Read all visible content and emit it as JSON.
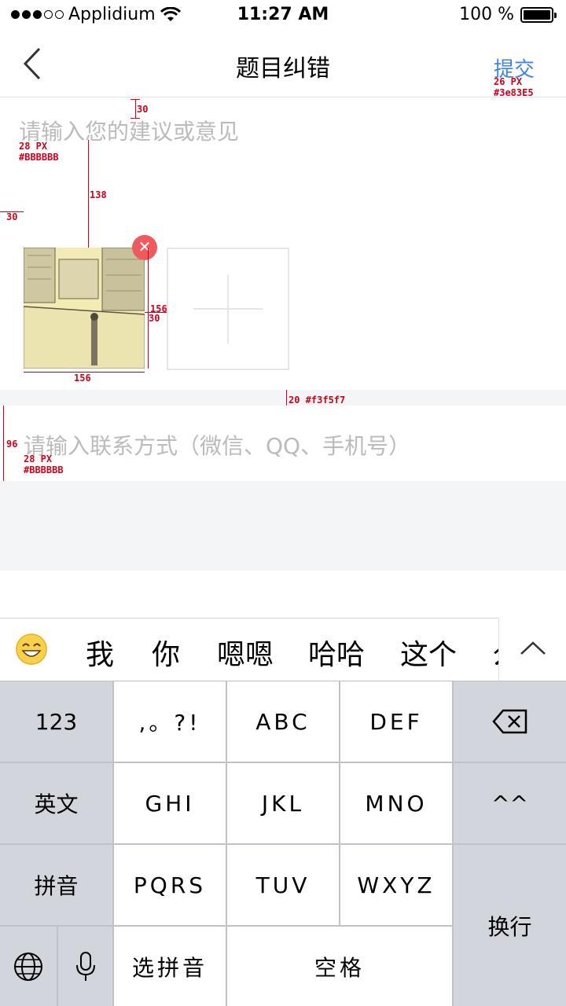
{
  "status_bar": {
    "carrier": "Applidium",
    "time": "11:27 AM",
    "battery": "100 %"
  },
  "nav": {
    "title": "题目纠错",
    "submit_label": "提交"
  },
  "feedback": {
    "placeholder": "请输入您的建议或意见"
  },
  "contact": {
    "placeholder": "请输入联系方式（微信、QQ、手机号）"
  },
  "annotations": {
    "top_gap": "30",
    "placeholder_font": "28 PX",
    "placeholder_color": "#BBBBBB",
    "gap_138": "138",
    "left_margin": "30",
    "thumb_height": "156",
    "thumb_gap": "30",
    "thumb_width": "156",
    "sep": "20 #f3f5f7",
    "row_height": "96",
    "contact_font": "28 PX",
    "contact_color": "#BBBBBB",
    "submit_font": "26 PX",
    "submit_color": "#3e83E5"
  },
  "colors": {
    "accent": "#3e83e5",
    "placeholder": "#bbbbbb",
    "separator": "#f3f5f7",
    "remove": "#ef5a5f"
  },
  "suggestions": [
    "我",
    "你",
    "嗯嗯",
    "哈哈",
    "这个",
    "么"
  ],
  "keyboard": {
    "row1": [
      "123",
      ",。?!",
      "ABC",
      "DEF"
    ],
    "row2": [
      "英文",
      "GHI",
      "JKL",
      "MNO",
      "^^"
    ],
    "row3": [
      "拼音",
      "PQRS",
      "TUV",
      "WXYZ"
    ],
    "row4": [
      "选拼音",
      "空格"
    ],
    "return": "换行"
  }
}
